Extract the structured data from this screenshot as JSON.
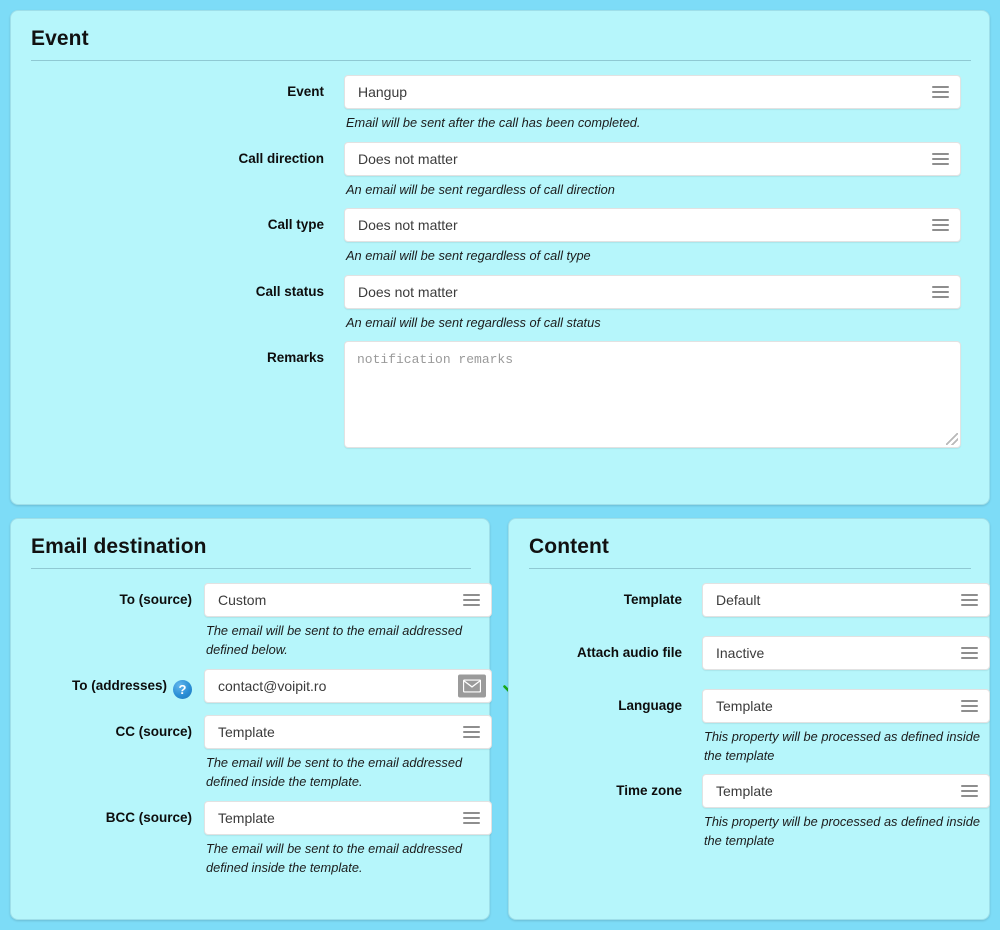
{
  "theme": {
    "page_bg": "#7ddcf7",
    "panel_bg": "#b6f6fb",
    "panel_border": "#9fdfe9",
    "accent_help": "#2a8fd6",
    "valid_check": "#18a818",
    "field_bg": "#ffffff"
  },
  "event_panel": {
    "title": "Event",
    "fields": [
      {
        "label": "Event",
        "control": "select",
        "value": "Hangup",
        "icon": "hamburger-icon",
        "hint": "Email will be sent after the call has been completed."
      },
      {
        "label": "Call direction",
        "control": "select",
        "value": "Does not matter",
        "icon": "hamburger-icon",
        "hint": "An email will be sent regardless of call direction"
      },
      {
        "label": "Call type",
        "control": "select",
        "value": "Does not matter",
        "icon": "hamburger-icon",
        "hint": "An email will be sent regardless of call type"
      },
      {
        "label": "Call status",
        "control": "select",
        "value": "Does not matter",
        "icon": "hamburger-icon",
        "hint": "An email will be sent regardless of call status"
      },
      {
        "label": "Remarks",
        "control": "textarea",
        "value": "",
        "placeholder": "notification remarks",
        "hint": ""
      }
    ]
  },
  "email_destination_panel": {
    "title": "Email destination",
    "fields": [
      {
        "label": "To (source)",
        "control": "select",
        "value": "Custom",
        "icon": "hamburger-icon",
        "hint": "The email will be sent to the email addressed defined below."
      },
      {
        "label": "To (addresses)",
        "control": "text",
        "value": "contact@voipit.ro",
        "placeholder": "",
        "help_icon": "question-mark-icon",
        "addon_icon": "envelope-icon",
        "status_icon": "check-icon",
        "hint": ""
      },
      {
        "label": "CC (source)",
        "control": "select",
        "value": "Template",
        "icon": "hamburger-icon",
        "hint": "The email will be sent to the email addressed defined inside the template."
      },
      {
        "label": "BCC (source)",
        "control": "select",
        "value": "Template",
        "icon": "hamburger-icon",
        "hint": "The email will be sent to the email addressed defined inside the template."
      }
    ]
  },
  "content_panel": {
    "title": "Content",
    "fields": [
      {
        "label": "Template",
        "control": "select",
        "value": "Default",
        "icon": "hamburger-icon",
        "hint": ""
      },
      {
        "label": "Attach audio file",
        "control": "select",
        "value": "Inactive",
        "icon": "hamburger-icon",
        "hint": ""
      },
      {
        "label": "Language",
        "control": "select",
        "value": "Template",
        "icon": "hamburger-icon",
        "hint": "This property will be processed as defined inside the template"
      },
      {
        "label": "Time zone",
        "control": "select",
        "value": "Template",
        "icon": "hamburger-icon",
        "hint": "This property will be processed as defined inside the template"
      }
    ]
  }
}
